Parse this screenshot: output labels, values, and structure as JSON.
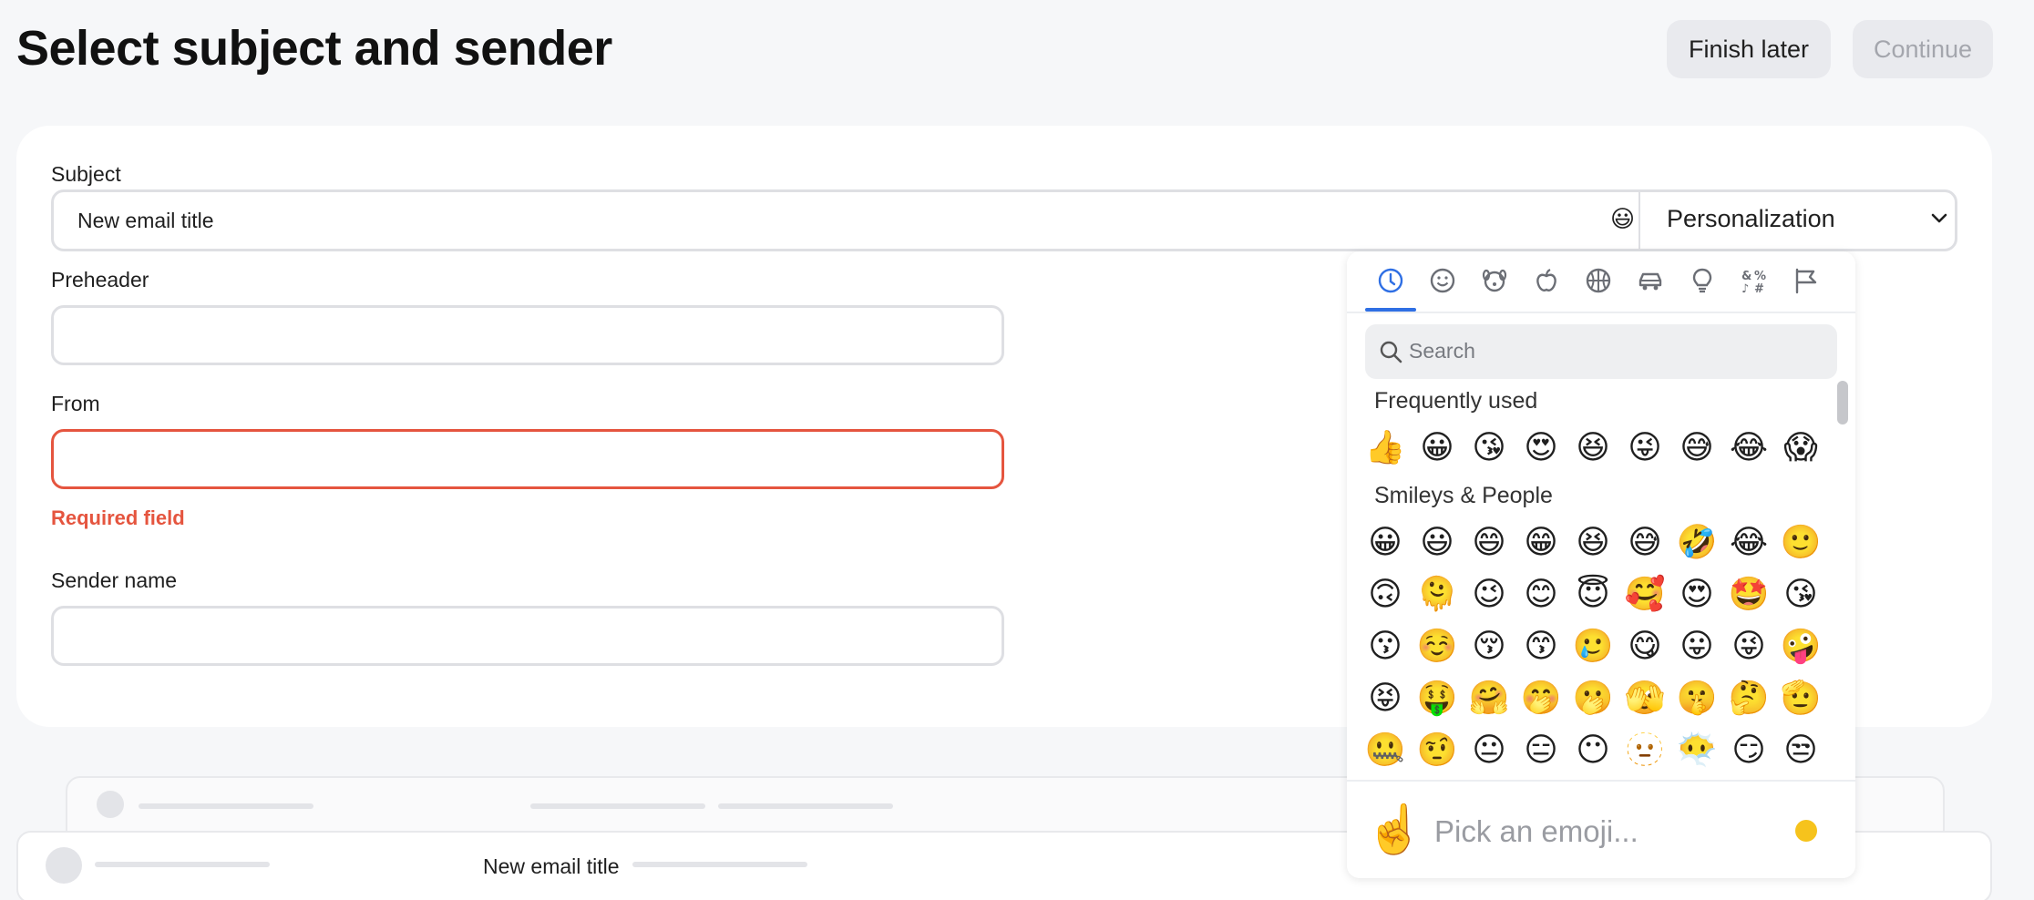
{
  "page": {
    "title": "Select subject and sender"
  },
  "header": {
    "finish_later_label": "Finish later",
    "continue_label": "Continue"
  },
  "form": {
    "subject": {
      "label": "Subject",
      "value": "New email title",
      "emoji_icon": "smiley-icon",
      "personalization_label": "Personalization"
    },
    "preheader": {
      "label": "Preheader",
      "value": ""
    },
    "from": {
      "label": "From",
      "value": "",
      "error": "Required field"
    },
    "sender_name": {
      "label": "Sender name",
      "value": ""
    }
  },
  "emoji_picker": {
    "categories": [
      "recent-icon",
      "smileys-icon",
      "animals-icon",
      "food-icon",
      "activity-icon",
      "travel-icon",
      "objects-icon",
      "symbols-icon",
      "flags-icon"
    ],
    "search_placeholder": "Search",
    "frequently_used_title": "Frequently used",
    "frequently_used": [
      "👍",
      "😀",
      "😘",
      "😍",
      "😆",
      "😜",
      "😅",
      "😂",
      "😱"
    ],
    "smileys_title": "Smileys & People",
    "smileys": [
      [
        "😀",
        "😃",
        "😄",
        "😁",
        "😆",
        "😅",
        "🤣",
        "😂",
        "🙂"
      ],
      [
        "🙃",
        "🫠",
        "😉",
        "😊",
        "😇",
        "🥰",
        "😍",
        "🤩",
        "😘"
      ],
      [
        "😗",
        "☺️",
        "😚",
        "😙",
        "🥲",
        "😋",
        "😛",
        "😜",
        "🤪"
      ],
      [
        "😝",
        "🤑",
        "🤗",
        "🤭",
        "🫢",
        "🫣",
        "🤫",
        "🤔",
        "🫡"
      ],
      [
        "🤐",
        "🤨",
        "😐",
        "😑",
        "😶",
        "🫥",
        "😶‍🌫️",
        "😏",
        "😒"
      ]
    ],
    "footer_emoji": "☝️",
    "footer_placeholder": "Pick an emoji...",
    "skin_tone_color": "#f6c31c"
  },
  "preview": {
    "subject": "New email title"
  },
  "colors": {
    "error": "#e5553f",
    "accent": "#2f6fe4"
  }
}
